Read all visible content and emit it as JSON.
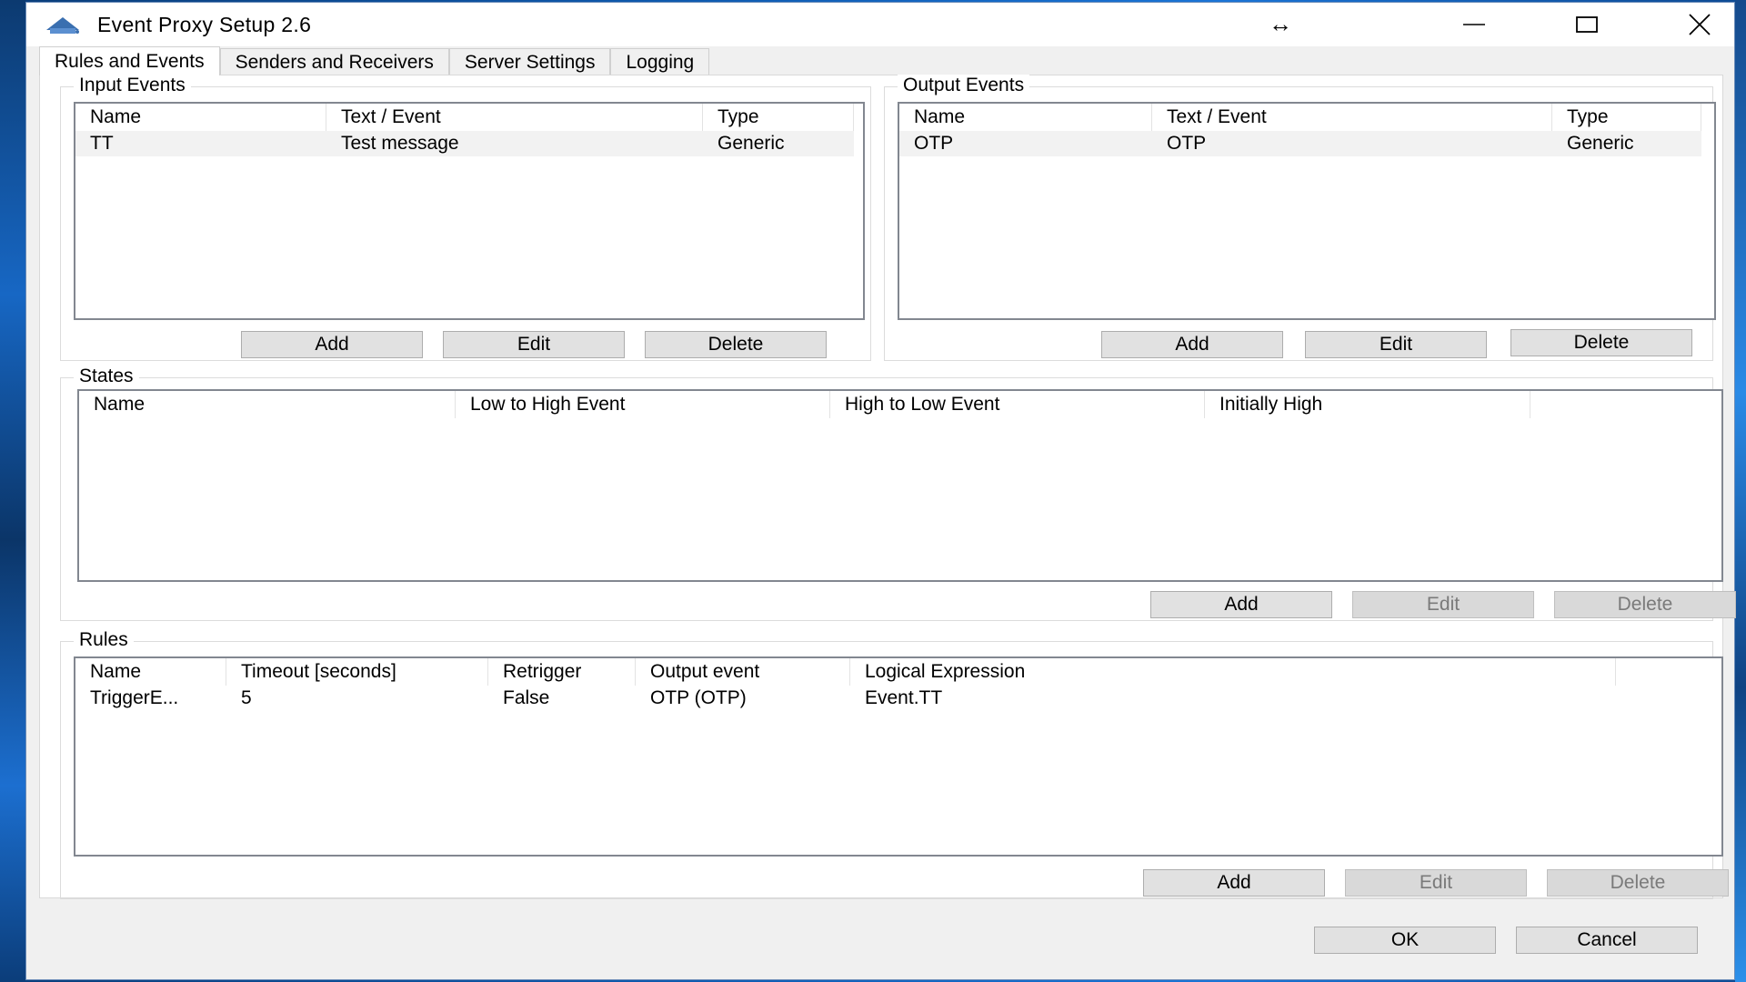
{
  "window": {
    "title": "Event Proxy Setup 2.6",
    "icon": "app-logo-icon",
    "controls": {
      "minimize": "minimize-icon",
      "maximize": "maximize-icon",
      "close": "close-icon"
    },
    "cursor": "resize-horizontal-cursor"
  },
  "tabs": [
    {
      "label": "Rules and Events",
      "active": true
    },
    {
      "label": "Senders and Receivers",
      "active": false
    },
    {
      "label": "Server Settings",
      "active": false
    },
    {
      "label": "Logging",
      "active": false
    }
  ],
  "input_events": {
    "title": "Input Events",
    "columns": [
      "Name",
      "Text / Event",
      "Type"
    ],
    "rows": [
      [
        "TT",
        "Test message",
        "Generic"
      ]
    ],
    "buttons": {
      "add": "Add",
      "edit": "Edit",
      "delete": "Delete"
    }
  },
  "output_events": {
    "title": "Output Events",
    "columns": [
      "Name",
      "Text / Event",
      "Type"
    ],
    "rows": [
      [
        "OTP",
        "OTP",
        "Generic"
      ]
    ],
    "buttons": {
      "add": "Add",
      "edit": "Edit",
      "delete": "Delete"
    }
  },
  "states": {
    "title": "States",
    "columns": [
      "Name",
      "Low to High Event",
      "High to Low Event",
      "Initially High"
    ],
    "rows": [],
    "buttons": {
      "add": "Add",
      "edit": "Edit",
      "delete": "Delete"
    }
  },
  "rules": {
    "title": "Rules",
    "columns": [
      "Name",
      "Timeout [seconds]",
      "Retrigger",
      "Output event",
      "Logical Expression"
    ],
    "rows": [
      [
        "TriggerE...",
        "5",
        "False",
        "OTP (OTP)",
        "Event.TT"
      ]
    ],
    "buttons": {
      "add": "Add",
      "edit": "Edit",
      "delete": "Delete"
    }
  },
  "dialog": {
    "ok": "OK",
    "cancel": "Cancel"
  },
  "colors": {
    "accent": "#0078d7",
    "desktop": "#0f5bb0",
    "window_bg": "#f0f0f0"
  }
}
